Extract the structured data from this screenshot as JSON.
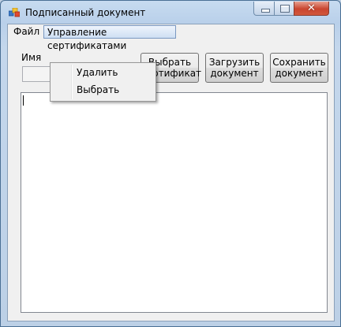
{
  "window": {
    "title": "Подписанный документ",
    "close_glyph": "✕"
  },
  "menubar": {
    "file_label": "Файл",
    "cert_label": "Управление сертификатами"
  },
  "cert_menu": {
    "items": [
      {
        "label": "Удалить"
      },
      {
        "label": "Выбрать"
      }
    ]
  },
  "form": {
    "name_label": "Имя",
    "name_value": "",
    "buttons": {
      "select_cert": {
        "line1": "Выбрать",
        "line2": "сертификат"
      },
      "load_doc": {
        "line1": "Загрузить",
        "line2": "документ"
      },
      "save_doc": {
        "line1": "Сохранить",
        "line2": "документ"
      }
    }
  },
  "document_text": "",
  "icons": [
    "app-icon",
    "minimize-icon",
    "maximize-icon",
    "close-icon"
  ]
}
